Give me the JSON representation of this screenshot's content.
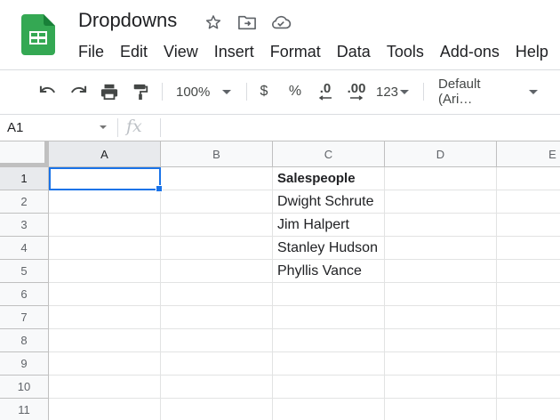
{
  "app": {
    "title": "Dropdowns",
    "brand_color": "#34a853",
    "icons": [
      "star-icon",
      "move-to-folder-icon",
      "cloud-status-icon"
    ]
  },
  "menu": [
    "File",
    "Edit",
    "View",
    "Insert",
    "Format",
    "Data",
    "Tools",
    "Add-ons",
    "Help"
  ],
  "toolbar": {
    "zoom": "100%",
    "currency": "$",
    "percent": "%",
    "decrease_decimal": ".0",
    "increase_decimal": ".00",
    "more_formats": "123",
    "font": "Default (Ari…"
  },
  "formula_bar": {
    "name_box": "A1",
    "fx": "fx",
    "formula": ""
  },
  "grid": {
    "columns": [
      "A",
      "B",
      "C",
      "D",
      "E"
    ],
    "rows": [
      "1",
      "2",
      "3",
      "4",
      "5",
      "6",
      "7",
      "8",
      "9",
      "10",
      "11"
    ],
    "selected_cell": "A1",
    "selection_color": "#1a73e8",
    "cells": {
      "C1": "Salespeople",
      "C2": "Dwight Schrute",
      "C3": "Jim Halpert",
      "C4": "Stanley Hudson",
      "C5": "Phyllis Vance"
    }
  }
}
